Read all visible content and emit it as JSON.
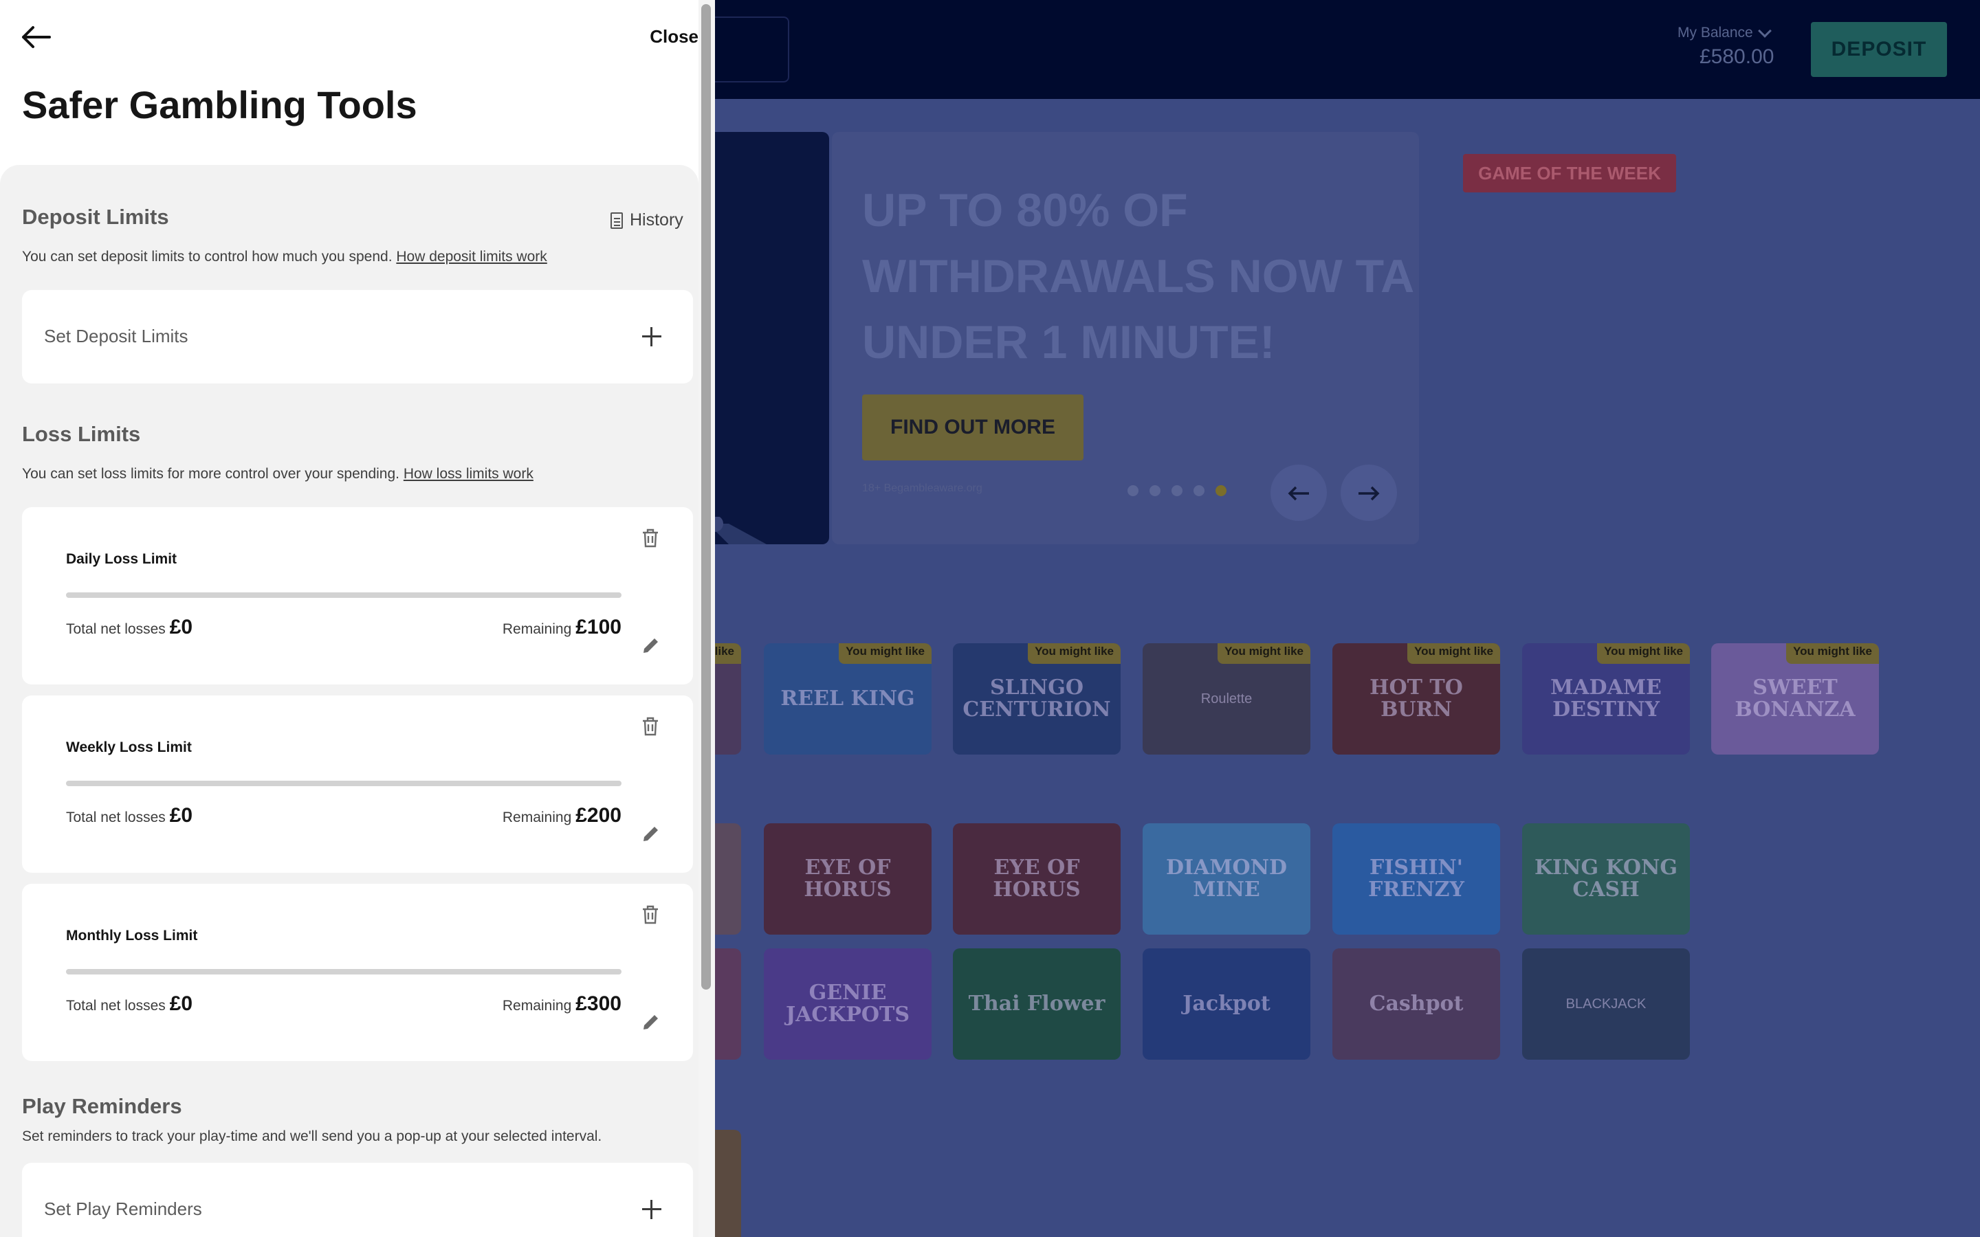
{
  "background": {
    "balance": {
      "label": "My Balance",
      "value": "£580.00"
    },
    "deposit_label": "DEPOSIT",
    "hero": {
      "headline_lines": [
        "UP TO 80% OF",
        "WITHDRAWALS NOW TA",
        "UNDER 1 MINUTE!"
      ],
      "cta": "FIND OUT MORE",
      "terms": "18+ Begambleaware.org",
      "dots_count": 5,
      "active_dot": 5
    },
    "game_of_week": "GAME OF THE WEEK",
    "tile_tag": "You might like",
    "rows": {
      "row1": [
        "",
        "REEL KING",
        "SLINGO CENTURION",
        "Roulette",
        "HOT TO BURN",
        "MADAME DESTINY",
        "SWEET BONANZA"
      ],
      "row2": [
        "",
        "EYE OF HORUS",
        "EYE OF HORUS",
        "DIAMOND MINE",
        "FISHIN' FRENZY",
        "KING KONG CASH"
      ],
      "row3": [
        "",
        "GENIE JACKPOTS",
        "Thai Flower",
        "Jackpot",
        "Cashpot",
        "BLACKJACK"
      ]
    }
  },
  "panel": {
    "close_label": "Close",
    "title": "Safer Gambling Tools",
    "deposit_limits": {
      "title": "Deposit Limits",
      "history_label": "History",
      "description": "You can set deposit limits to control how much you spend.",
      "link": "How deposit limits work",
      "set_label": "Set Deposit Limits"
    },
    "loss_limits": {
      "title": "Loss Limits",
      "description": "You can set loss limits for more control over your spending.",
      "link": "How loss limits work",
      "total_label": "Total net losses",
      "remaining_label": "Remaining",
      "items": [
        {
          "name": "Daily Loss Limit",
          "losses": "£0",
          "remaining": "£100",
          "progress": 0
        },
        {
          "name": "Weekly Loss Limit",
          "losses": "£0",
          "remaining": "£200",
          "progress": 0
        },
        {
          "name": "Monthly Loss Limit",
          "losses": "£0",
          "remaining": "£300",
          "progress": 0
        }
      ]
    },
    "play_reminders": {
      "title": "Play Reminders",
      "description": "Set reminders to track your play-time and we'll send you a pop-up at your selected interval.",
      "set_label": "Set Play Reminders"
    }
  },
  "colors": {
    "overlay_dim": "#3c4a82",
    "panel_bg": "#ffffff",
    "section_bg": "#f2f2f2",
    "cta_yellow_dim": "#6c6437",
    "deposit_teal_dim": "#1f5d5c"
  }
}
